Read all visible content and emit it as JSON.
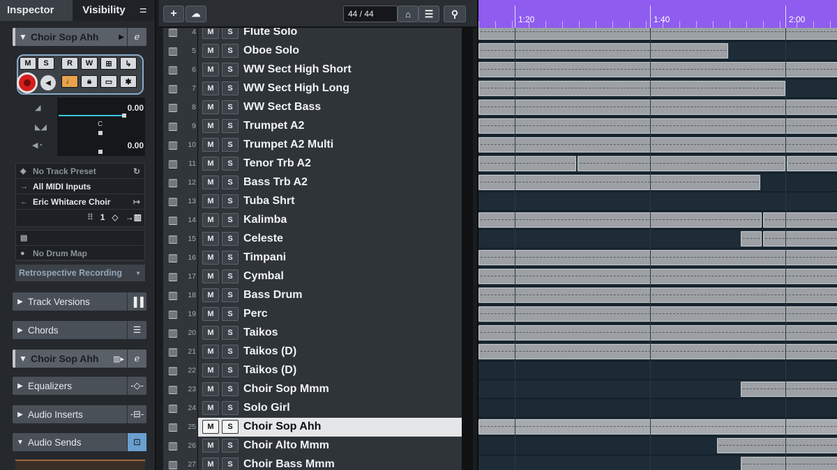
{
  "inspector": {
    "tab_inspector": "Inspector",
    "tab_visibility": "Visibility",
    "menu_glyph": "=",
    "track_name": "Choir Sop Ahh",
    "controls": {
      "mute": "M",
      "solo": "S",
      "read": "R",
      "write": "W",
      "fader_top_value": "0.00",
      "pan_label": "C",
      "fader_bottom_value": "0.00"
    },
    "fields": {
      "preset": "No Track Preset",
      "input": "All MIDI Inputs",
      "output": "Eric Whitacre Choir",
      "channel": "1",
      "drum_map": "No Drum Map",
      "retro": "Retrospective Recording"
    },
    "sections": {
      "track_versions": "Track Versions",
      "chords": "Chords",
      "track_name_2": "Choir Sop Ahh",
      "equalizers": "Equalizers",
      "audio_inserts": "Audio Inserts",
      "audio_sends": "Audio Sends"
    }
  },
  "toolbar": {
    "add_glyph": "+",
    "track_count": "44 / 44"
  },
  "tracks": [
    {
      "num": "4",
      "name": "Flute Solo"
    },
    {
      "num": "5",
      "name": "Oboe Solo"
    },
    {
      "num": "6",
      "name": "WW Sect High Short"
    },
    {
      "num": "7",
      "name": "WW Sect High Long"
    },
    {
      "num": "8",
      "name": "WW Sect Bass"
    },
    {
      "num": "9",
      "name": "Trumpet A2"
    },
    {
      "num": "10",
      "name": "Trumpet A2 Multi"
    },
    {
      "num": "11",
      "name": "Tenor Trb A2"
    },
    {
      "num": "12",
      "name": "Bass Trb A2"
    },
    {
      "num": "13",
      "name": "Tuba Shrt"
    },
    {
      "num": "14",
      "name": "Kalimba"
    },
    {
      "num": "15",
      "name": "Celeste"
    },
    {
      "num": "16",
      "name": "Timpani"
    },
    {
      "num": "17",
      "name": "Cymbal"
    },
    {
      "num": "18",
      "name": "Bass Drum"
    },
    {
      "num": "19",
      "name": "Perc"
    },
    {
      "num": "20",
      "name": "Taikos"
    },
    {
      "num": "21",
      "name": "Taikos (D)"
    },
    {
      "num": "22",
      "name": "Taikos (D)"
    },
    {
      "num": "23",
      "name": "Choir Sop Mmm"
    },
    {
      "num": "24",
      "name": "Solo Girl"
    },
    {
      "num": "25",
      "name": "Choir Sop Ahh",
      "selected": true
    },
    {
      "num": "26",
      "name": "Choir Alto Mmm"
    },
    {
      "num": "27",
      "name": "Choir Bass Mmm"
    }
  ],
  "track_buttons": {
    "mute": "M",
    "solo": "S"
  },
  "ruler": {
    "labels": [
      "1:20",
      "1:40",
      "2:00"
    ]
  },
  "colors": {
    "ruler": "#8f5cf0",
    "record": "#d51e1e",
    "fader_line": "#38c6e6",
    "selected_row": "#e4e6e8"
  }
}
